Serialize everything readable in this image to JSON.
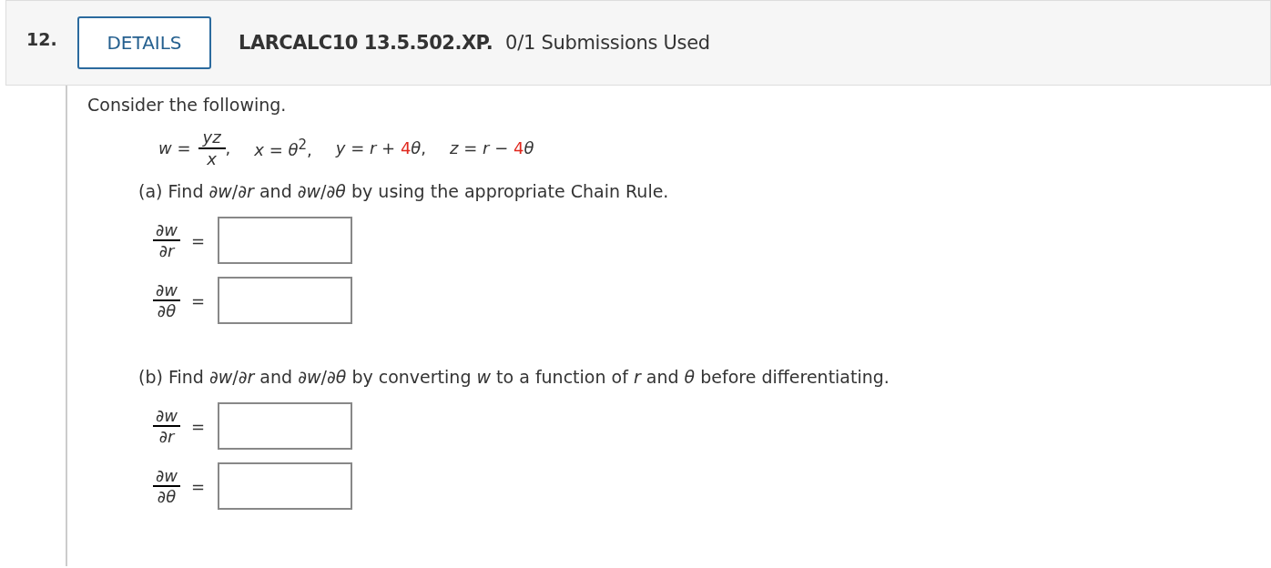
{
  "header": {
    "number": "12.",
    "details_button": "DETAILS",
    "problem_id": "LARCALC10 13.5.502.XP.",
    "submissions": "0/1 Submissions Used"
  },
  "intro": "Consider the following.",
  "given": {
    "fraction": {
      "lhs": "*w* =",
      "numerator": "*yz*",
      "denominator": "*x*",
      "after": ","
    },
    "equations": [
      {
        "parts": [
          {
            "text": "*x* = *θ*$^{2}$,",
            "random": false
          }
        ]
      },
      {
        "parts": [
          {
            "text": "*y* = *r* + ",
            "random": false
          },
          {
            "text": "4",
            "random": true
          },
          {
            "text": "*θ*,",
            "random": false
          }
        ]
      },
      {
        "parts": [
          {
            "text": "*z* = *r* − ",
            "random": false
          },
          {
            "text": "4",
            "random": true
          },
          {
            "text": "*θ*",
            "random": false
          }
        ]
      }
    ]
  },
  "parts": [
    {
      "prompt": "(a) Find ∂*w*/∂*r* and ∂*w*/∂*θ* by using the appropriate Chain Rule.",
      "answers": [
        {
          "numerator": "∂*w*",
          "denominator": "∂*r*",
          "equals": "="
        },
        {
          "numerator": "∂*w*",
          "denominator": "∂*θ*",
          "equals": "="
        }
      ]
    },
    {
      "prompt": "(b) Find ∂*w*/∂*r* and ∂*w*/∂*θ* by converting *w* to a function of *r* and *θ* before differentiating.",
      "answers": [
        {
          "numerator": "∂*w*",
          "denominator": "∂*r*",
          "equals": "="
        },
        {
          "numerator": "∂*w*",
          "denominator": "∂*θ*",
          "equals": "="
        }
      ]
    }
  ]
}
